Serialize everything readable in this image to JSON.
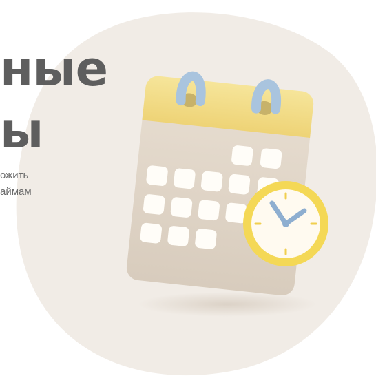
{
  "hero": {
    "title_lines": [
      "ные",
      "ы"
    ],
    "subtitle_lines": [
      "ожить",
      "аймам"
    ]
  },
  "illustration": {
    "icon": "calendar-with-clock-icon",
    "colors": {
      "background_blob": "#f1ece6",
      "calendar_header": "#f3dd84",
      "calendar_body": "#e2d7ca",
      "day_tile": "#fffdf8",
      "binder_ring": "#a9c4de",
      "clock_rim": "#f4d856",
      "clock_face": "#fffaf0",
      "clock_hands": "#8eaed0"
    }
  }
}
